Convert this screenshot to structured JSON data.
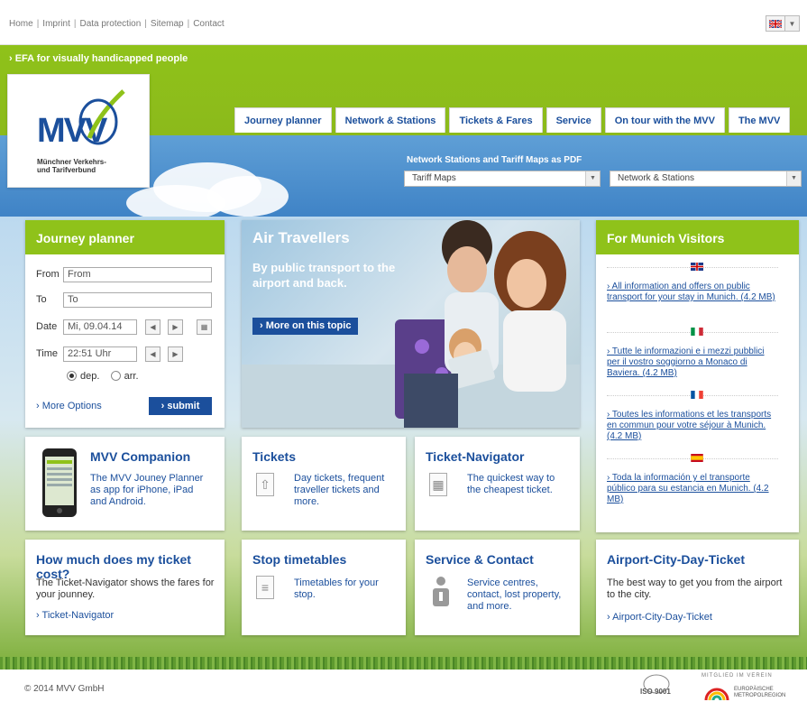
{
  "top_links": [
    "Home",
    "Imprint",
    "Data protection",
    "Sitemap",
    "Contact"
  ],
  "efa_link": "› EFA for visually handicapped people",
  "logo": {
    "name": "MVV",
    "subtitle_line1": "Münchner Verkehrs-",
    "subtitle_line2": "und Tarifverbund"
  },
  "nav": [
    "Journey planner",
    "Network & Stations",
    "Tickets & Fares",
    "Service",
    "On tour with the MVV",
    "The MVV"
  ],
  "pdf_title": "Network Stations and Tariff Maps as PDF",
  "select_tariff": "Tariff Maps",
  "select_network": "Network & Stations",
  "journey": {
    "title": "Journey planner",
    "from_label": "From",
    "from_value": "From",
    "to_label": "To",
    "to_value": "To",
    "date_label": "Date",
    "date_value": "Mi, 09.04.14",
    "time_label": "Time",
    "time_value": "22:51 Uhr",
    "dep": "dep.",
    "arr": "arr.",
    "more_options": "› More Options",
    "submit": "› submit"
  },
  "hero": {
    "title": "Air Travellers",
    "subtitle": "By public transport to the airport and back.",
    "more": "› More on this topic"
  },
  "companion": {
    "title": "MVV Companion",
    "text": "The MVV Jouney Planner as app for iPhone, iPad and Android."
  },
  "tickets": {
    "title": "Tickets",
    "text": "Day tickets, frequent traveller tickets and more."
  },
  "navigator": {
    "title": "Ticket-Navigator",
    "text": "The quickest way to the cheapest ticket."
  },
  "cost": {
    "title": "How much does my ticket cost?",
    "text": "The Ticket-Navigator shows the fares for your jounney.",
    "link": "› Ticket-Navigator"
  },
  "timetables": {
    "title": "Stop timetables",
    "text": "Timetables for your stop."
  },
  "service": {
    "title": "Service & Contact",
    "text": "Service centres, contact, lost property, and more."
  },
  "visitors": {
    "title": "For Munich Visitors",
    "items": [
      "› All information and offers on public transport for your stay in Munich. (4.2 MB)",
      "› Tutte le informazioni e i mezzi pubblici per il vostro soggiorno a Monaco di Baviera. (4.2 MB)",
      "› Toutes les informations et les transports en commun pour votre séjour à Munich. (4.2 MB)",
      "› Toda la información y el transporte público para su estancia en Munich. (4.2 MB)"
    ]
  },
  "airport": {
    "title": "Airport-City-Day-Ticket",
    "text": "The best way to get you from the airport to the city.",
    "link": "› Airport-City-Day-Ticket"
  },
  "footer": {
    "copyright": "© 2014 MVV GmbH",
    "iso": "ISO 9001",
    "member": "MITGLIED IM VEREIN",
    "metro": "EUROPÄISCHE METROPOLREGION"
  },
  "colors": {
    "green": "#8fc21a",
    "blue": "#1b4f9c"
  }
}
